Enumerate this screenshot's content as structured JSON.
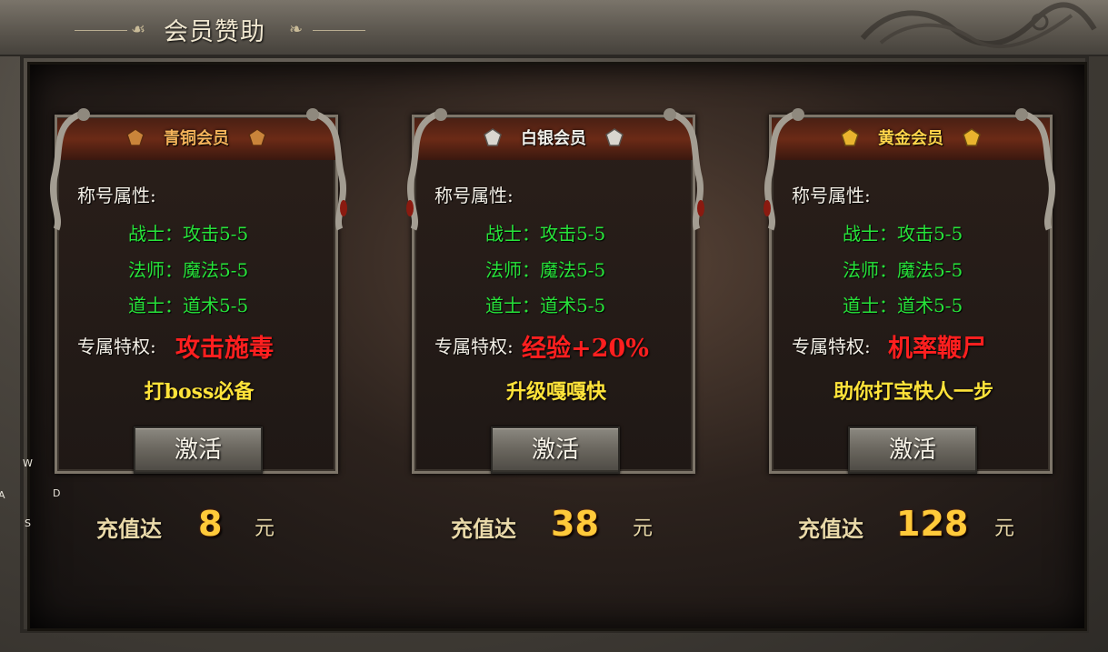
{
  "window": {
    "title": "会员赞助"
  },
  "side_letters": {
    "w": "W",
    "a": "A",
    "d": "D",
    "s": "S"
  },
  "colors": {
    "stat_green": "#27e33a",
    "privilege_red": "#ff1f1f",
    "slogan_yellow": "#ffe33a"
  },
  "cards": [
    {
      "title": "青铜会员",
      "attr_label": "称号属性:",
      "stats": [
        "战士：攻击5-5",
        "法师：魔法5-5",
        "道士：道术5-5"
      ],
      "privilege_label": "专属特权:",
      "privilege_value": "攻击施毒",
      "slogan": "打boss必备",
      "button_label": "激活",
      "recharge_prefix": "充值达",
      "recharge_amount": "8",
      "recharge_unit": "元"
    },
    {
      "title": "白银会员",
      "attr_label": "称号属性:",
      "stats": [
        "战士：攻击5-5",
        "法师：魔法5-5",
        "道士：道术5-5"
      ],
      "privilege_label": "专属特权:",
      "privilege_value": "经验+20%",
      "slogan": "升级嘎嘎快",
      "button_label": "激活",
      "recharge_prefix": "充值达",
      "recharge_amount": "38",
      "recharge_unit": "元"
    },
    {
      "title": "黄金会员",
      "attr_label": "称号属性:",
      "stats": [
        "战士：攻击5-5",
        "法师：魔法5-5",
        "道士：道术5-5"
      ],
      "privilege_label": "专属特权:",
      "privilege_value": "机率鞭尸",
      "slogan": "助你打宝快人一步",
      "button_label": "激活",
      "recharge_prefix": "充值达",
      "recharge_amount": "128",
      "recharge_unit": "元"
    }
  ]
}
